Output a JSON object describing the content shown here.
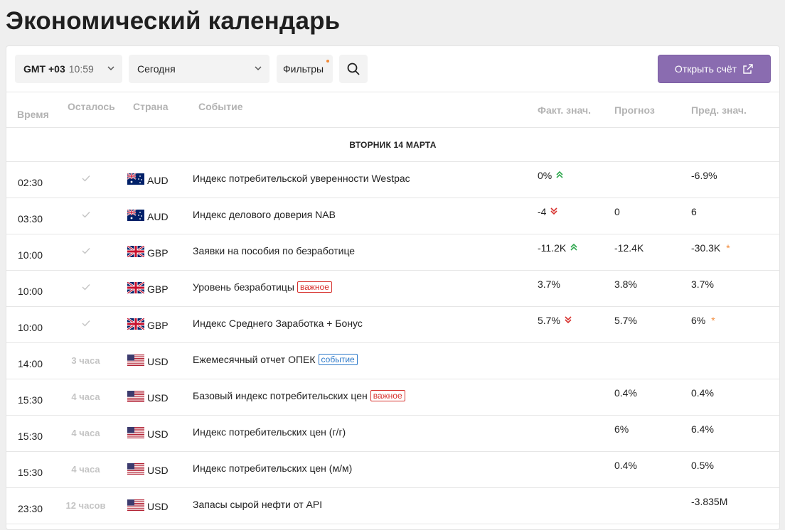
{
  "title": "Экономический календарь",
  "toolbar": {
    "tz_offset": "GMT +03",
    "tz_time": "10:59",
    "period": "Сегодня",
    "filters": "Фильтры",
    "open_account": "Открыть счёт"
  },
  "columns": {
    "time": "Время",
    "remaining": "Осталось",
    "country": "Страна",
    "event": "Событие",
    "actual": "Факт. знач.",
    "forecast": "Прогноз",
    "previous": "Пред. знач."
  },
  "date_header": "ВТОРНИК 14 МАРТА",
  "colors": {
    "accent": "#8a6cb0",
    "up": "#2fa84f",
    "down": "#d7322e",
    "important": "#d7322e",
    "event": "#2b78c9"
  },
  "rows": [
    {
      "time": "02:30",
      "remaining": "",
      "done": true,
      "currency": "AUD",
      "flag": "au",
      "event": "Индекс потребительской уверенности Westpac",
      "badge": "",
      "badge_type": "",
      "actual": "0%",
      "trend": "up",
      "forecast": "",
      "previous": "-6.9%",
      "revised": false
    },
    {
      "time": "03:30",
      "remaining": "",
      "done": true,
      "currency": "AUD",
      "flag": "au",
      "event": "Индекс делового доверия NAB",
      "badge": "",
      "badge_type": "",
      "actual": "-4",
      "trend": "down",
      "forecast": "0",
      "previous": "6",
      "revised": false
    },
    {
      "time": "10:00",
      "remaining": "",
      "done": true,
      "currency": "GBP",
      "flag": "gb",
      "event": "Заявки на пособия по безработице",
      "badge": "",
      "badge_type": "",
      "actual": "-11.2K",
      "trend": "up",
      "forecast": "-12.4K",
      "previous": "-30.3K",
      "revised": true
    },
    {
      "time": "10:00",
      "remaining": "",
      "done": true,
      "currency": "GBP",
      "flag": "gb",
      "event": "Уровень безработицы",
      "badge": "важное",
      "badge_type": "imp",
      "actual": "3.7%",
      "trend": "",
      "forecast": "3.8%",
      "previous": "3.7%",
      "revised": false
    },
    {
      "time": "10:00",
      "remaining": "",
      "done": true,
      "currency": "GBP",
      "flag": "gb",
      "event": "Индекс Среднего Заработка + Бонус",
      "badge": "",
      "badge_type": "",
      "actual": "5.7%",
      "trend": "down",
      "forecast": "5.7%",
      "previous": "6%",
      "revised": true
    },
    {
      "time": "14:00",
      "remaining": "3 часа",
      "done": false,
      "currency": "USD",
      "flag": "us",
      "event": "Ежемесячный отчет ОПЕК",
      "badge": "событие",
      "badge_type": "evt",
      "actual": "",
      "trend": "",
      "forecast": "",
      "previous": "",
      "revised": false
    },
    {
      "time": "15:30",
      "remaining": "4 часа",
      "done": false,
      "currency": "USD",
      "flag": "us",
      "event": "Базовый индекс потребительских цен",
      "badge": "важное",
      "badge_type": "imp",
      "actual": "",
      "trend": "",
      "forecast": "0.4%",
      "previous": "0.4%",
      "revised": false
    },
    {
      "time": "15:30",
      "remaining": "4 часа",
      "done": false,
      "currency": "USD",
      "flag": "us",
      "event": "Индекс потребительских цен (г/г)",
      "badge": "",
      "badge_type": "",
      "actual": "",
      "trend": "",
      "forecast": "6%",
      "previous": "6.4%",
      "revised": false
    },
    {
      "time": "15:30",
      "remaining": "4 часа",
      "done": false,
      "currency": "USD",
      "flag": "us",
      "event": "Индекс потребительских цен (м/м)",
      "badge": "",
      "badge_type": "",
      "actual": "",
      "trend": "",
      "forecast": "0.4%",
      "previous": "0.5%",
      "revised": false
    },
    {
      "time": "23:30",
      "remaining": "12 часов",
      "done": false,
      "currency": "USD",
      "flag": "us",
      "event": "Запасы сырой нефти от API",
      "badge": "",
      "badge_type": "",
      "actual": "",
      "trend": "",
      "forecast": "",
      "previous": "-3.835M",
      "revised": false
    }
  ]
}
